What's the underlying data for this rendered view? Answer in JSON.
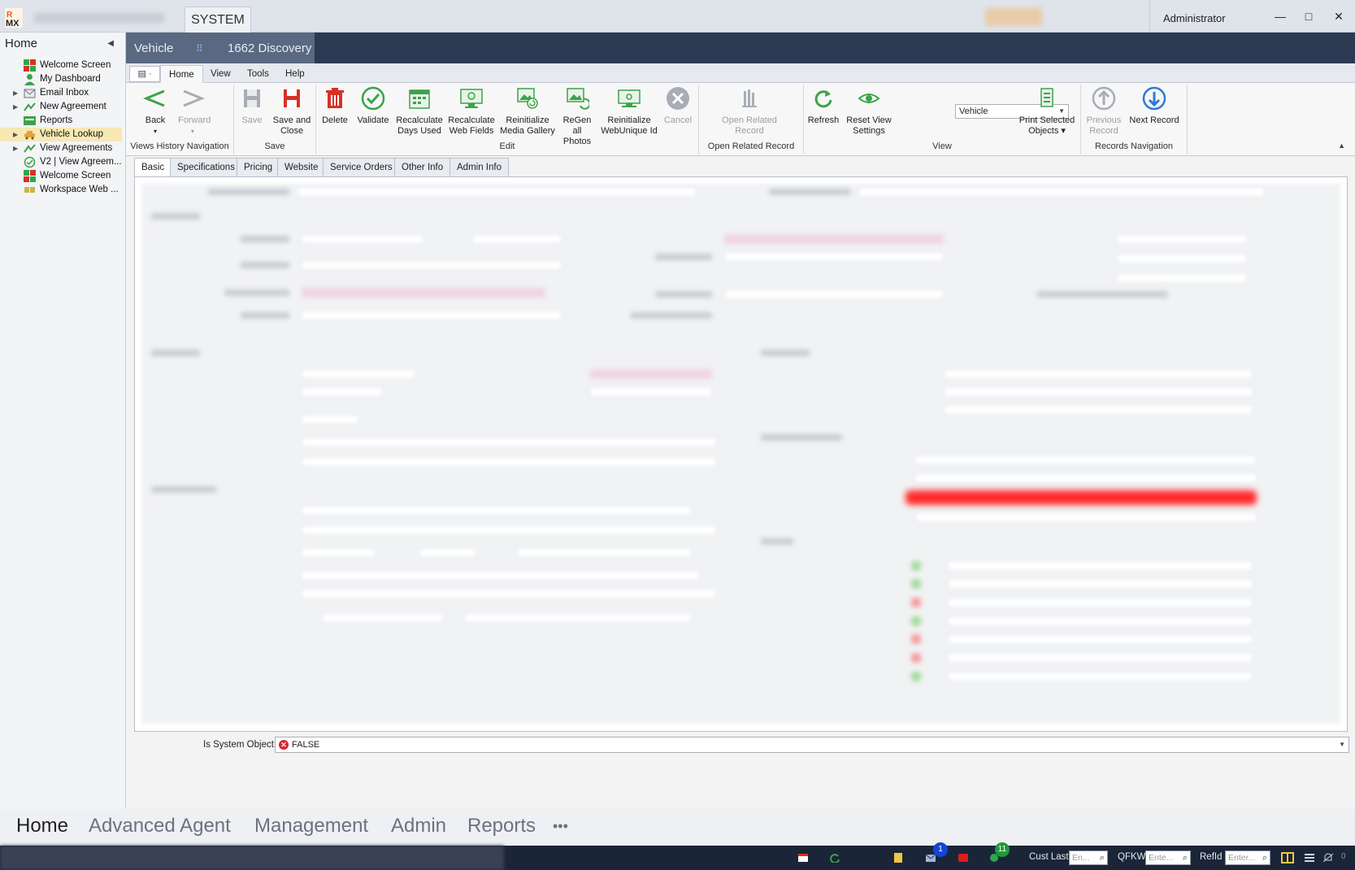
{
  "titlebar": {
    "system_tab": "SYSTEM",
    "user": "Administrator",
    "minimize": "—",
    "maximize": "□",
    "close": "✕"
  },
  "sidebar": {
    "title": "Home",
    "items": [
      {
        "label": "Welcome Screen",
        "icon": "welcome-icon"
      },
      {
        "label": "My Dashboard",
        "icon": "dashboard-user-icon"
      },
      {
        "label": "Email Inbox",
        "icon": "email-icon"
      },
      {
        "label": "New Agreement",
        "icon": "agreement-icon"
      },
      {
        "label": "Reports",
        "icon": "reports-icon"
      },
      {
        "label": "Vehicle Lookup",
        "icon": "vehicle-icon"
      },
      {
        "label": "View Agreements",
        "icon": "agreement-icon"
      },
      {
        "label": "V2 | View Agreem...",
        "icon": "check-circle-icon"
      },
      {
        "label": "Welcome Screen",
        "icon": "welcome-icon"
      },
      {
        "label": "Workspace Web ...",
        "icon": "workspace-icon"
      }
    ]
  },
  "document": {
    "tab_title": "Vehicle",
    "tab_sep": "⠿",
    "record_name": "1662 Discovery"
  },
  "ribbon": {
    "file_tab": "▤ ·",
    "tabs": [
      "Home",
      "View",
      "Tools",
      "Help"
    ],
    "buttons": {
      "back": "Back",
      "forward": "Forward",
      "save": "Save",
      "save_close_1": "Save and",
      "save_close_2": "Close",
      "delete": "Delete",
      "validate": "Validate",
      "recalc_days_1": "Recalculate",
      "recalc_days_2": "Days Used",
      "recalc_web_1": "Recalculate",
      "recalc_web_2": "Web Fields",
      "reinit_media_1": "Reinitialize",
      "reinit_media_2": "Media Gallery",
      "regen_1": "ReGen all",
      "regen_2": "Photos",
      "reinit_web_1": "Reinitialize",
      "reinit_web_2": "WebUnique Id",
      "cancel": "Cancel",
      "open_related_1": "Open Related",
      "open_related_2": "Record",
      "refresh": "Refresh",
      "reset_view_1": "Reset View",
      "reset_view_2": "Settings",
      "print_1": "Print Selected",
      "print_2": "Objects ▾",
      "prev_1": "Previous",
      "prev_2": "Record",
      "next": "Next Record"
    },
    "view_combo": "Vehicle",
    "groups": {
      "history": "Views History Navigation",
      "save": "Save",
      "edit": "Edit",
      "open_related": "Open Related Record",
      "view": "View",
      "records": "Records Navigation"
    }
  },
  "form_tabs": [
    "Basic",
    "Specifications",
    "Pricing",
    "Website",
    "Service Orders",
    "Other Info",
    "Admin Info"
  ],
  "system_object": {
    "label": "Is System Object:",
    "value": "FALSE"
  },
  "bottom_nav": [
    "Home",
    "Advanced Agent",
    "Management",
    "Admin",
    "Reports",
    "•••"
  ],
  "status_bar": {
    "mail_badge": "1",
    "chat_badge": "11",
    "cust_last_label": "Cust Last",
    "cust_last_placeholder": "En...",
    "qfkw_label": "QFKW",
    "qfkw_placeholder": "Ente...",
    "refid_label": "RefId",
    "refid_placeholder": "Enter...",
    "notif_count": "0"
  }
}
